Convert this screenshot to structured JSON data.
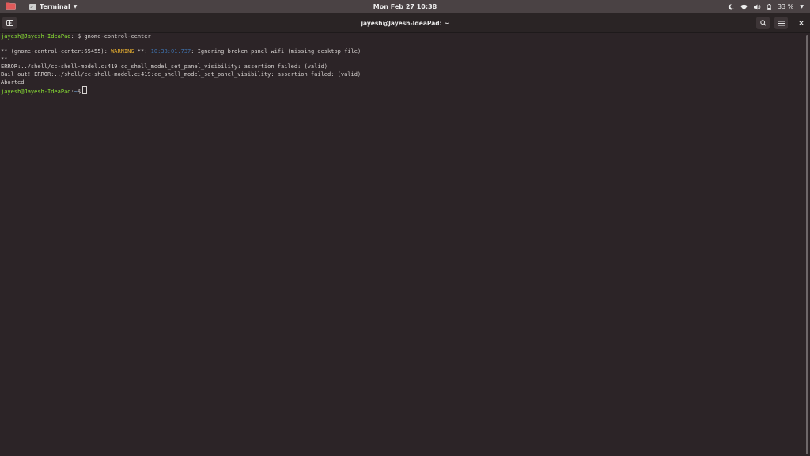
{
  "topbar": {
    "app_name": "Terminal",
    "clock": "Mon Feb 27  10:38",
    "battery": "33 %"
  },
  "window": {
    "title": "jayesh@Jayesh-IdeaPad: ~"
  },
  "terminal": {
    "prompt_user": "jayesh@Jayesh-IdeaPad",
    "prompt_path": "~",
    "prompt_symbol": "$",
    "command": "gnome-control-center",
    "warn_prefix": "** (gnome-control-center:65455): ",
    "warn_label": "WARNING",
    "warn_mid": " **: ",
    "warn_time": "10:38:01.737",
    "warn_text": ": Ignoring broken panel wifi (missing desktop file)",
    "line_stars": "**",
    "error_line": "ERROR:../shell/cc-shell-model.c:419:cc_shell_model_set_panel_visibility: assertion failed: (valid)",
    "bailout_line": "Bail out! ERROR:../shell/cc-shell-model.c:419:cc_shell_model_set_panel_visibility: assertion failed: (valid)",
    "aborted_line": "Aborted"
  },
  "icons": {
    "activities": "folder-icon",
    "new_tab": "new-tab-icon",
    "search": "search-icon",
    "menu": "hamburger-menu-icon",
    "close": "close-icon",
    "night_light": "moon-icon",
    "network": "wifi-icon",
    "volume": "speaker-icon",
    "battery": "battery-icon"
  },
  "colors": {
    "background": "#2c2427",
    "topbar": "#4a4244",
    "prompt_user": "#8ae234",
    "prompt_path": "#729fcf",
    "warning": "#e9b030",
    "timestamp": "#3f74b0"
  }
}
